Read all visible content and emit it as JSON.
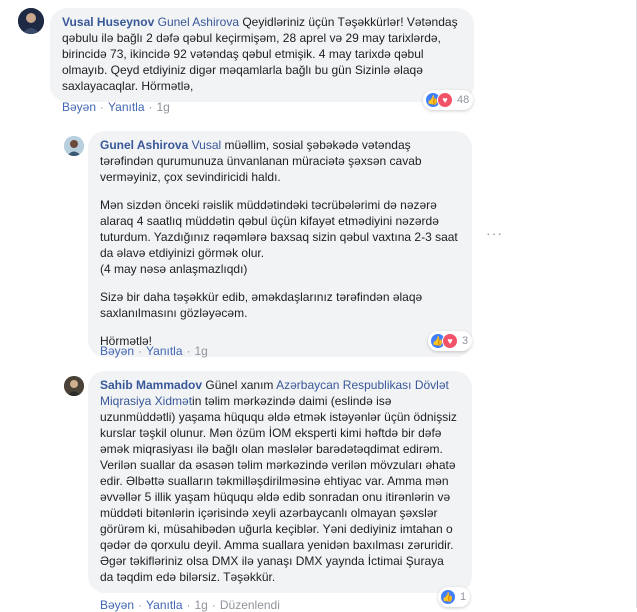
{
  "comments": [
    {
      "author": "Vusal Huseynov",
      "mention": "Gunel Ashirova",
      "paragraphs": [
        "Qeyidləriniz üçün Təşəkkürlər! Vətəndaş qəbulu ilə bağlı 2 dəfə qəbul keçirmişəm, 28 aprel və 29 may tarixlərdə, birincidə 73, ikincidə 92 vətəndaş qəbul etmişik. 4 may tarixdə qəbul olmayıb. Qeyd etdiyiniz digər məqamlarla bağlı bu gün Sizinlə əlaqə saxlayacaqlar. Hörmətlə,"
      ],
      "like": "Bəyən",
      "reply": "Yanıtla",
      "time": "1g",
      "reaction_count": "48"
    },
    {
      "author": "Gunel Ashirova",
      "mention": "Vusal",
      "paragraphs": [
        "müəllim, sosial şəbəkədə vətəndaş tərəfindən qurumunuza ünvanlanan müraciətə şəxsən cavab verməyiniz, çox sevindiricidi haldı.",
        "Mən sizdən önceki rəislik müddətindəki təcrübələrimi də nəzərə alaraq 4 saatlıq müddətin qəbul üçün kifayət etmədiyini nəzərdə tuturdum. Yazdığınız rəqəmlərə baxsaq sizin qəbul vaxtına 2-3 saat da əlavə etdiyinizi görmək olur.\n(4 may nəsə anlaşmazlıqdı)",
        "Sizə bir daha təşəkkür edib, əməkdaşlarınız tərəfindən əlaqə saxlanılmasını gözləyəcəm.",
        "Hörmətlə!"
      ],
      "like": "Bəyən",
      "reply": "Yanıtla",
      "time": "1g",
      "reaction_count": "3"
    },
    {
      "author": "Sahib Mammadov",
      "pre_mention": "Günel xanım",
      "mention": "Azərbaycan Respublikası Dövlət Miqrasiya Xidmət",
      "paragraphs": [
        "in təlim mərkəzində daimi (eslində isə uzunmüddətli) yaşama hüququ əldə etmək istəyənlər üçün ödnişsiz kurslar təşkil olunur. Mən özüm İOM eksperti kimi həftdə bir dəfə əmək miqrasiyası ilə bağlı olan məslələr barədətəqdimat edirəm. Verilən suallar da əsasən təlim mərkəzində verilən mövzuları əhatə edir. Əlbəttə sualların təkmilləşdirilməsinə ehtiyac var. Amma mən əvvəllər 5 illik yaşam hüququ əldə edib sonradan onu itirənlərin və müddəti bitənlərin içərisində xeyli azərbaycanlı olmayan şəxslər görürəm ki, müsahibədən uğurla keçiblər. Yəni dediyiniz imtahan o qədər də qorxulu deyil. Amma suallara yenidən baxılması zəruridir. Əgər təkifləriniz olsa DMX ilə yanaşı DMX yaynda İctimai Şuraya da təqdim edə bilərsiz. Təşəkkür."
      ],
      "like": "Bəyən",
      "reply": "Yanıtla",
      "time": "1g",
      "edited": "Düzenlendi",
      "reaction_count": "1"
    }
  ],
  "more_options": "···"
}
